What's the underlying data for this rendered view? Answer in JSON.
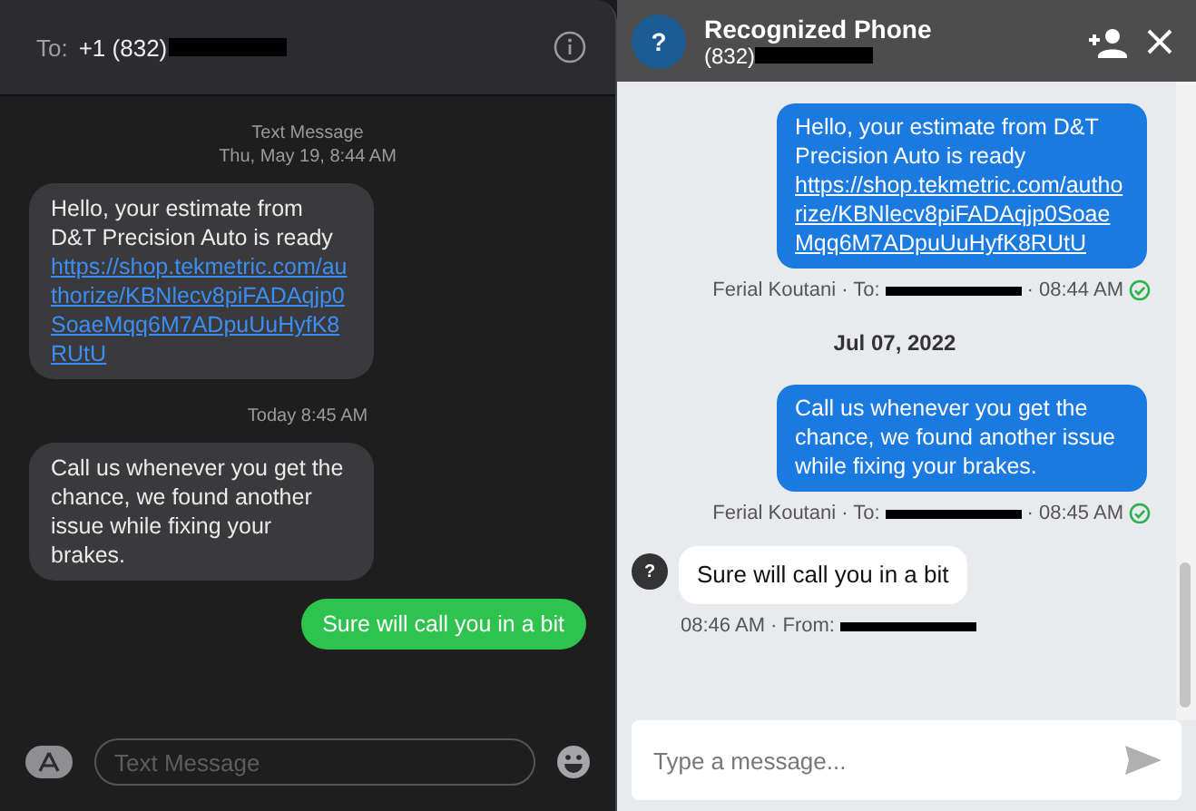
{
  "imessage": {
    "to_label": "To:",
    "recipient": "+1 (832)",
    "items": [
      {
        "kind": "timestamp",
        "service": "Text Message",
        "time": "Thu, May 19, 8:44 AM"
      },
      {
        "kind": "received",
        "text": "Hello, your estimate from D&T Precision Auto is ready",
        "link": "https://shop.tekmetric.com/authorize/KBNlecv8piFADAqjp0SoaeMqq6M7ADpuUuHyfK8RUtU"
      },
      {
        "kind": "timestamp",
        "time": "Today 8:45 AM"
      },
      {
        "kind": "received",
        "text": "Call us whenever you get the chance, we found another issue while fixing your brakes."
      },
      {
        "kind": "sent",
        "text": "Sure will call you in a bit"
      }
    ],
    "compose_placeholder": "Text Message"
  },
  "webchat": {
    "avatar": "?",
    "title": "Recognized Phone",
    "subtitle": "(832)",
    "items": [
      {
        "kind": "outgoing",
        "text": "Hello, your estimate from D&T Precision Auto is ready",
        "link": "https://shop.tekmetric.com/authorize/KBNlecv8piFADAqjp0SoaeMqq6M7ADpuUuHyfK8RUtU",
        "meta_before": "Ferial Koutani · To:",
        "meta_after": "· 08:44 AM",
        "delivered": true
      },
      {
        "kind": "date",
        "text": "Jul 07, 2022"
      },
      {
        "kind": "outgoing",
        "text": "Call us whenever you get the chance, we found another issue while fixing your brakes.",
        "meta_before": "Ferial Koutani · To:",
        "meta_after": "· 08:45 AM",
        "delivered": true
      },
      {
        "kind": "incoming",
        "avatar": "?",
        "text": "Sure will call you in a bit",
        "meta_before": "08:46 AM · From:"
      }
    ],
    "compose_placeholder": "Type a message..."
  }
}
